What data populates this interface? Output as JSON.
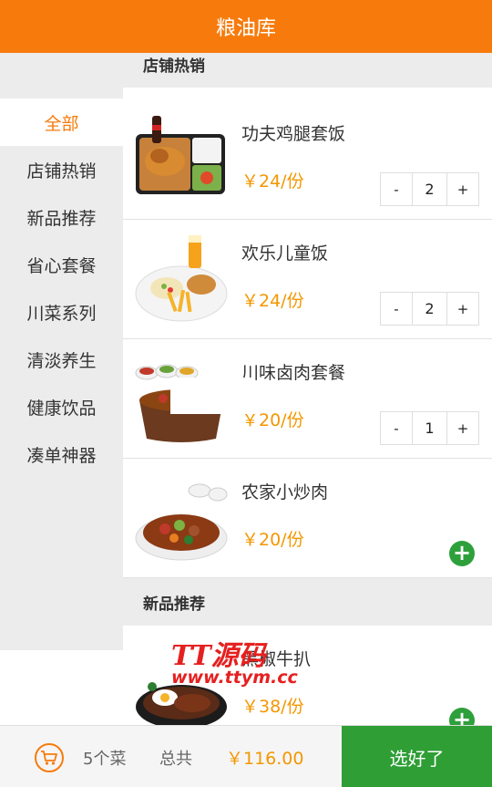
{
  "header": {
    "title": "粮油库"
  },
  "sidebar": {
    "items": [
      {
        "label": "全部",
        "active": true
      },
      {
        "label": "店铺热销"
      },
      {
        "label": "新品推荐"
      },
      {
        "label": "省心套餐"
      },
      {
        "label": "川菜系列"
      },
      {
        "label": "清淡养生"
      },
      {
        "label": "健康饮品"
      },
      {
        "label": "凑单神器"
      }
    ]
  },
  "sections": [
    {
      "title": "店铺热销"
    },
    {
      "title": "新品推荐"
    }
  ],
  "items": [
    {
      "name": "功夫鸡腿套饭",
      "price": "￥24/份",
      "quantity": "2"
    },
    {
      "name": "欢乐儿童饭",
      "price": "￥24/份",
      "quantity": "2"
    },
    {
      "name": "川味卤肉套餐",
      "price": "￥20/份",
      "quantity": "1"
    },
    {
      "name": "农家小炒肉",
      "price": "￥20/份"
    },
    {
      "name": "黑椒牛扒",
      "price": "￥38/份"
    }
  ],
  "stepper": {
    "minus": "-",
    "plus": "+"
  },
  "add_symbol": "+",
  "watermark": {
    "top": "TT源码",
    "bottom": "www.ttym.cc"
  },
  "footer": {
    "count": "5个菜",
    "total_label": "总共",
    "total_value": "￥116.00",
    "done_label": "选好了"
  },
  "colors": {
    "brand": "#f77b0c",
    "price": "#f39700",
    "confirm": "#2e9e35"
  }
}
